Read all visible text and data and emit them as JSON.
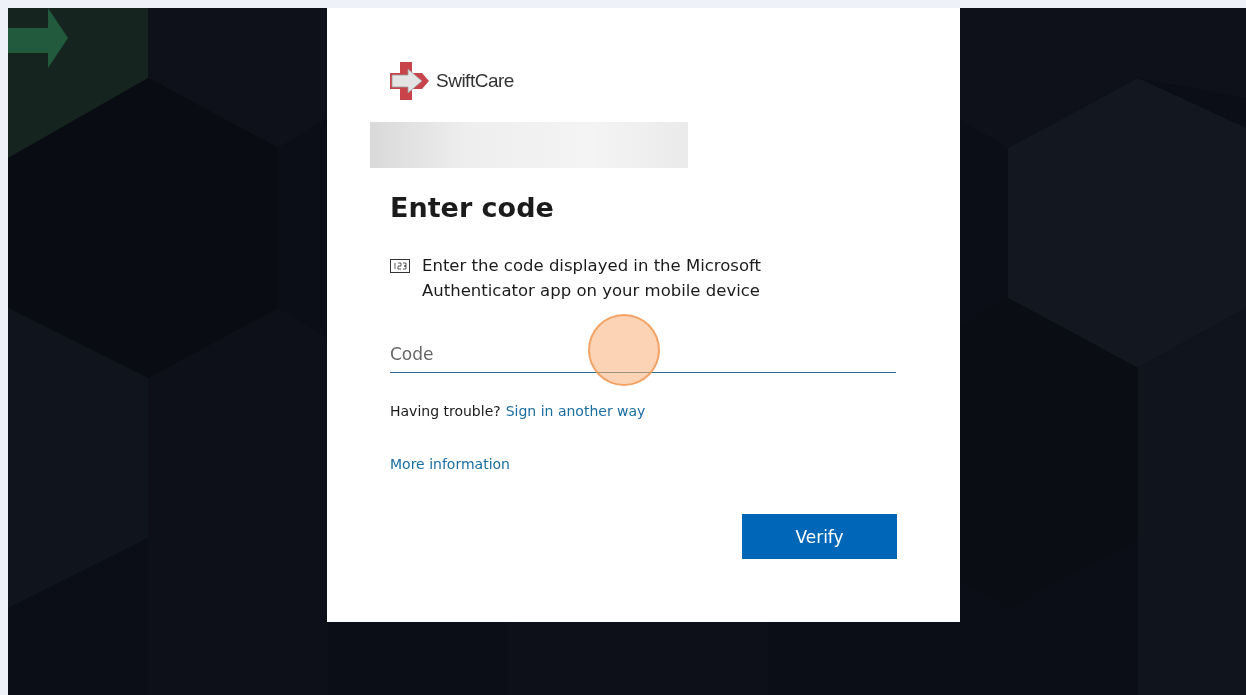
{
  "brand": {
    "name": "SwiftCare"
  },
  "title": "Enter code",
  "instruction": "Enter the code displayed in the Microsoft Authenticator app on your mobile device",
  "code_field": {
    "placeholder": "Code"
  },
  "trouble": {
    "prompt": "Having trouble?",
    "link": "Sign in another way"
  },
  "more_info_link": "More information",
  "buttons": [
    {
      "label": "Verify",
      "kind": "primary"
    }
  ]
}
